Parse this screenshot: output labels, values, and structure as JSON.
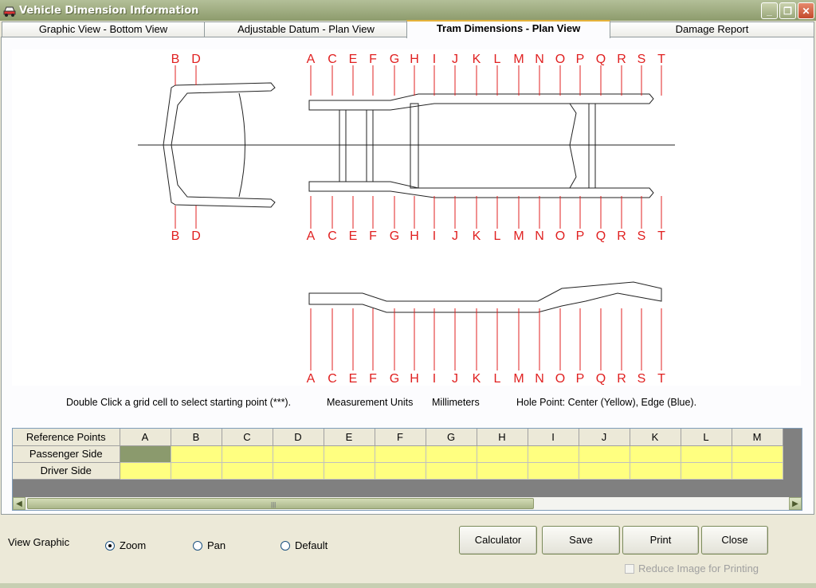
{
  "window": {
    "title": "Vehicle Dimension Information",
    "minimize": "_",
    "restore": "❐",
    "close": "✕"
  },
  "tabs": [
    {
      "label": "Graphic View - Bottom View",
      "active": false
    },
    {
      "label": "Adjustable Datum - Plan View",
      "active": false
    },
    {
      "label": "Tram Dimensions - Plan View",
      "active": true
    },
    {
      "label": "Damage Report",
      "active": false
    }
  ],
  "diagram": {
    "front_letters": [
      "B",
      "D"
    ],
    "frame_letters": [
      "A",
      "C",
      "E",
      "F",
      "G",
      "H",
      "I",
      "J",
      "K",
      "L",
      "M",
      "N",
      "O",
      "P",
      "Q",
      "R",
      "S",
      "T"
    ],
    "label_color": "#e02020"
  },
  "info": {
    "instruction": "Double Click a grid cell to select starting point (***).",
    "units_label": "Measurement Units",
    "units_value": "Millimeters",
    "hole_point": "Hole Point: Center (Yellow), Edge (Blue)."
  },
  "grid": {
    "corner": "Reference Points",
    "columns": [
      "A",
      "B",
      "C",
      "D",
      "E",
      "F",
      "G",
      "H",
      "I",
      "J",
      "K",
      "L",
      "M"
    ],
    "rows": [
      "Passenger Side",
      "Driver Side"
    ],
    "cell_color": "#ffff80",
    "selected_color": "#8b9a6d"
  },
  "view_graphic": {
    "label": "View Graphic",
    "options": [
      {
        "label": "Zoom",
        "checked": true
      },
      {
        "label": "Pan",
        "checked": false
      },
      {
        "label": "Default",
        "checked": false
      }
    ]
  },
  "buttons": {
    "calculator": "Calculator",
    "save": "Save",
    "print": "Print",
    "close": "Close"
  },
  "reduce_image": {
    "label": "Reduce Image for Printing",
    "checked": false,
    "enabled": false
  }
}
